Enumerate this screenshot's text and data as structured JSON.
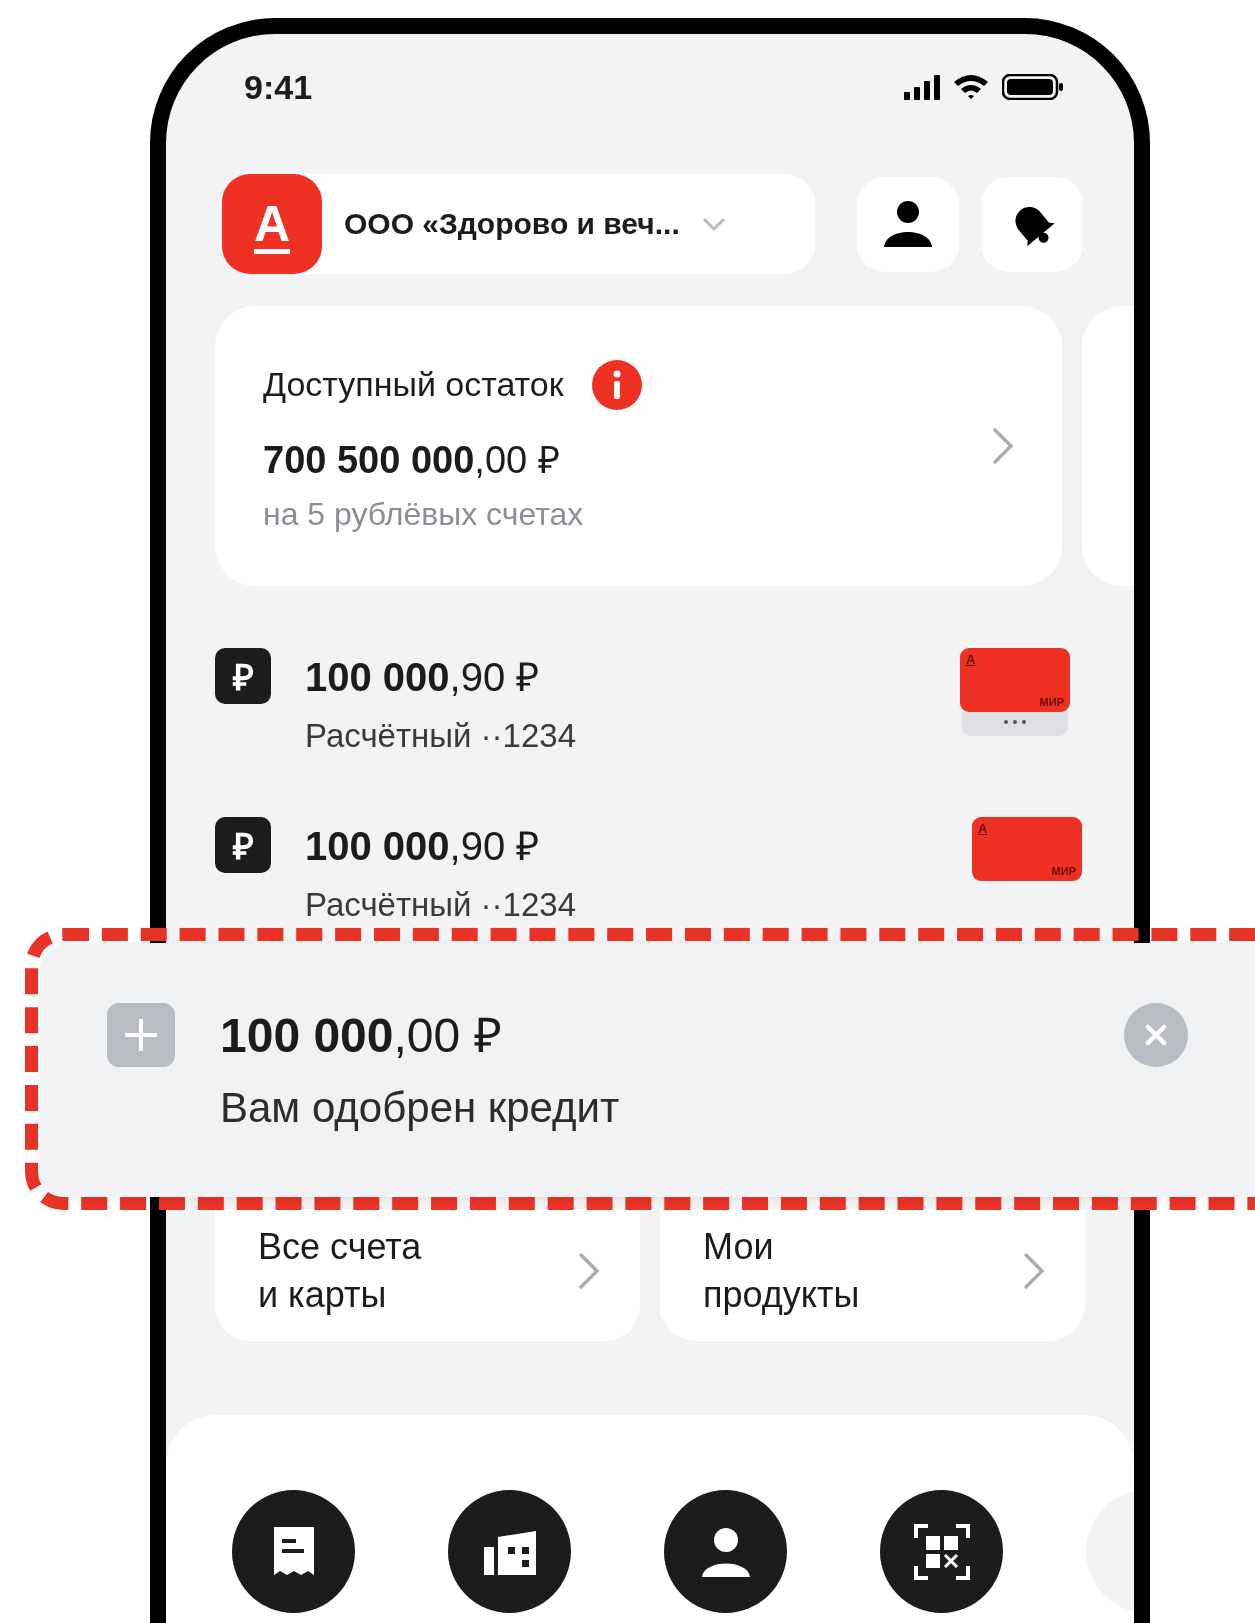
{
  "status_bar": {
    "time": "9:41"
  },
  "header": {
    "logo": "А",
    "company": "ООО «Здорово и веч..."
  },
  "balance": {
    "label": "Доступный остаток",
    "amount": "**700 500 000**,00 ₽",
    "note": "на 5 рублёвых счетах"
  },
  "accounts": [
    {
      "currency_icon": "₽",
      "amount": "**100 000**,90 ₽",
      "name": "Расчётный ··1234",
      "card_logo": "А",
      "card_brand": "МИР",
      "more_cards": true
    },
    {
      "currency_icon": "₽",
      "amount": "**100 000**,90 ₽",
      "name": "Расчётный ··1234",
      "card_logo": "А",
      "card_brand": "МИР",
      "more_cards": false
    }
  ],
  "shortcuts": [
    {
      "label": "Все счета\nи карты"
    },
    {
      "label": "Мои\nпродукты"
    }
  ],
  "quick_actions": [
    {
      "kind": "receipt"
    },
    {
      "kind": "building"
    },
    {
      "kind": "person"
    },
    {
      "kind": "qr"
    },
    {
      "kind": "more"
    }
  ],
  "promo": {
    "amount": "**100 000**,00 ₽",
    "text": "Вам одобрен кредит"
  }
}
